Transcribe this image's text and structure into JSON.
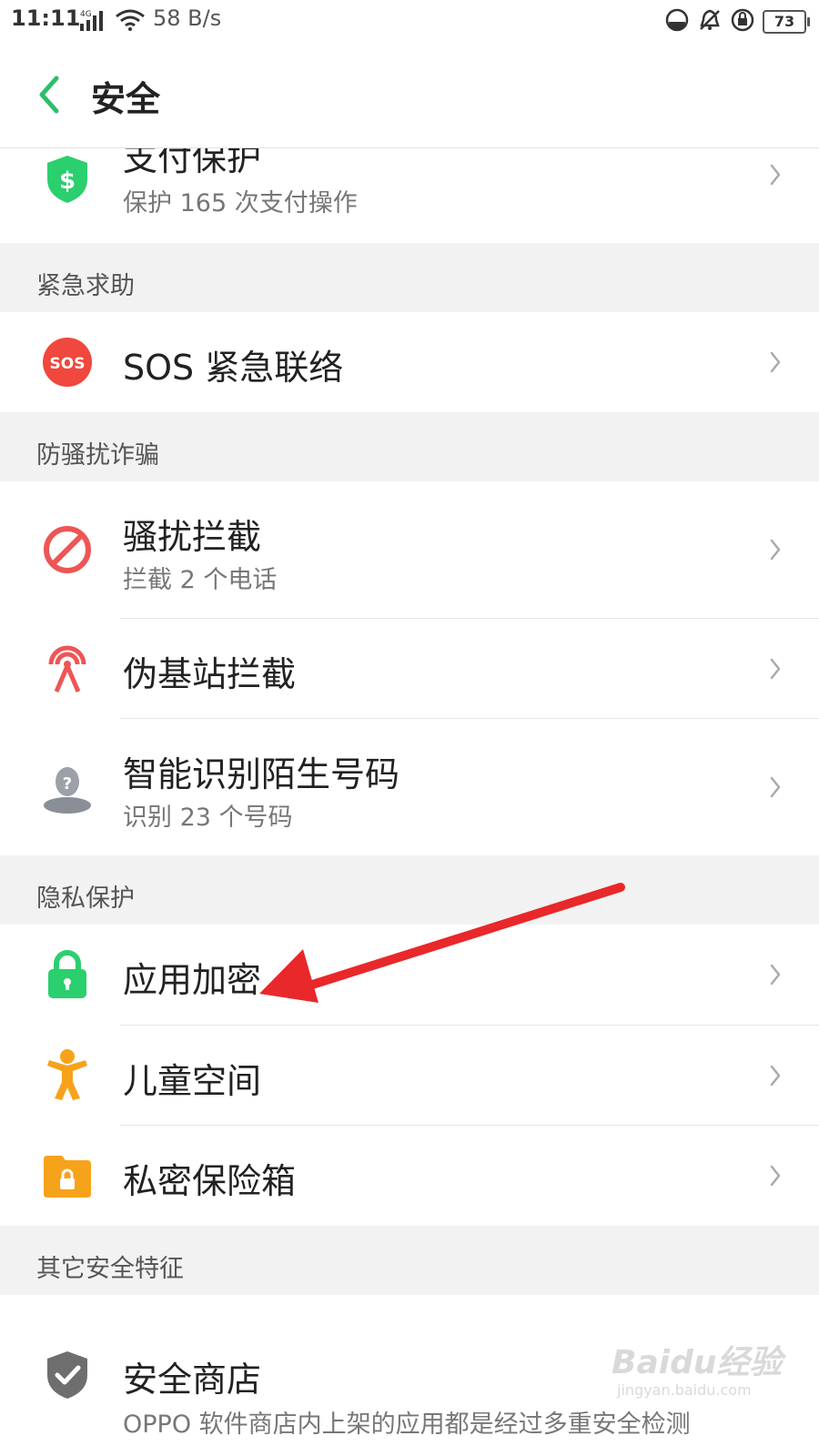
{
  "status_bar": {
    "time": "11:11",
    "network_type": "4G",
    "speed": "58 B/s",
    "battery": "73"
  },
  "header": {
    "title": "安全",
    "back_icon": "chevron-left-icon"
  },
  "colors": {
    "accent": "#2bbf6a",
    "sos_red": "#f0473e",
    "block_red": "#ee5555",
    "orange": "#f7a21b",
    "arrow_red": "#e8282a"
  },
  "items_top": [
    {
      "label": "支付保护",
      "sub": "保护 165 次支付操作",
      "icon": "shield-dollar-icon"
    }
  ],
  "sections": [
    {
      "header": "紧急求助",
      "items": [
        {
          "label": "SOS 紧急联络",
          "icon": "sos-icon",
          "icon_text": "SOS"
        }
      ]
    },
    {
      "header": "防骚扰诈骗",
      "items": [
        {
          "label": "骚扰拦截",
          "sub": "拦截 2 个电话",
          "icon": "block-icon"
        },
        {
          "label": "伪基站拦截",
          "icon": "tower-icon"
        },
        {
          "label": "智能识别陌生号码",
          "sub": "识别 23 个号码",
          "icon": "unknown-person-icon"
        }
      ]
    },
    {
      "header": "隐私保护",
      "items": [
        {
          "label": "应用加密",
          "icon": "lock-icon"
        },
        {
          "label": "儿童空间",
          "icon": "child-icon"
        },
        {
          "label": "私密保险箱",
          "icon": "lock-folder-icon"
        }
      ]
    },
    {
      "header": "其它安全特征",
      "items": [
        {
          "label": "安全商店",
          "sub": "OPPO 软件商店内上架的应用都是经过多重安全检测",
          "icon": "shield-check-icon"
        }
      ]
    }
  ],
  "watermark": {
    "brand": "Baidu经验",
    "url": "jingyan.baidu.com"
  }
}
